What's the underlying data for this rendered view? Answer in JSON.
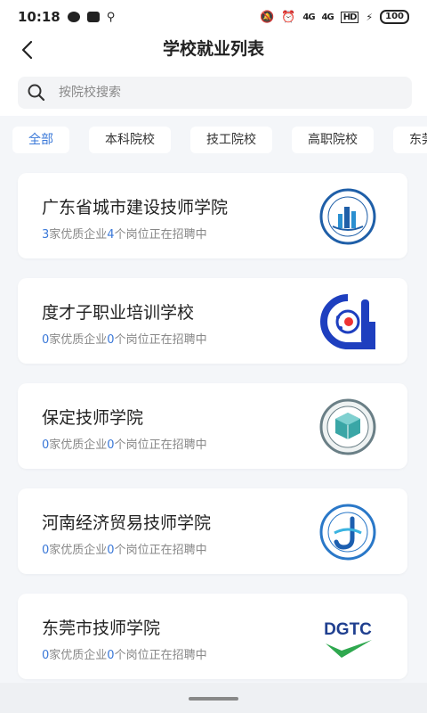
{
  "status": {
    "time": "10:18",
    "battery": "100",
    "signal1": "4G",
    "signal2": "4G",
    "hd": "HD"
  },
  "header": {
    "title": "学校就业列表"
  },
  "search": {
    "placeholder": "按院校搜索"
  },
  "tabs": [
    "全部",
    "本科院校",
    "技工院校",
    "高职院校",
    "东莞市"
  ],
  "schools": [
    {
      "name": "广东省城市建设技师学院",
      "companies": "3",
      "companies_suffix": "家优质企业",
      "positions": "4",
      "positions_suffix": "个岗位正在招聘中"
    },
    {
      "name": "度才子职业培训学校",
      "companies": "0",
      "companies_suffix": "家优质企业",
      "positions": "0",
      "positions_suffix": "个岗位正在招聘中"
    },
    {
      "name": "保定技师学院",
      "companies": "0",
      "companies_suffix": "家优质企业",
      "positions": "0",
      "positions_suffix": "个岗位正在招聘中"
    },
    {
      "name": "河南经济贸易技师学院",
      "companies": "0",
      "companies_suffix": "家优质企业",
      "positions": "0",
      "positions_suffix": "个岗位正在招聘中"
    },
    {
      "name": "东莞市技师学院",
      "companies": "0",
      "companies_suffix": "家优质企业",
      "positions": "0",
      "positions_suffix": "个岗位正在招聘中"
    }
  ],
  "logo_text": {
    "dgtc": "DGTC"
  },
  "colors": {
    "accent": "#3a78d8",
    "text": "#222222",
    "muted": "#888888",
    "background": "#f4f6f9"
  }
}
